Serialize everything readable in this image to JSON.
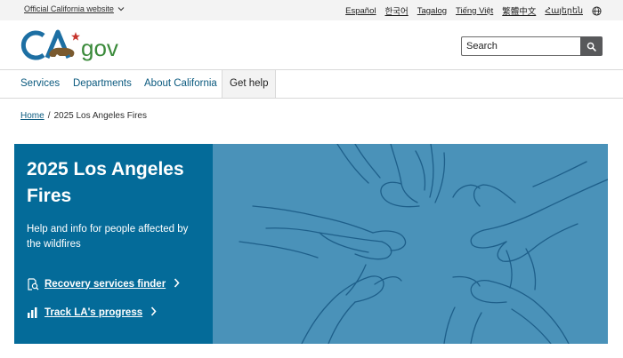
{
  "utility": {
    "official_label": "Official California website",
    "languages": [
      "Español",
      "한국어",
      "Tagalog",
      "Tiếng Việt",
      "繁體中文",
      "Հայերեն"
    ]
  },
  "header": {
    "logo_text": "CA",
    "logo_gov": "gov",
    "search_placeholder": "Search"
  },
  "nav": {
    "items": [
      "Services",
      "Departments",
      "About California",
      "Get help"
    ]
  },
  "breadcrumb": {
    "home": "Home",
    "separator": "/",
    "current": "2025 Los Angeles Fires"
  },
  "hero": {
    "title": "2025 Los Angeles Fires",
    "description": "Help and info for people affected by the wildfires",
    "links": [
      "Recovery services finder",
      "Track LA's progress"
    ],
    "colors": {
      "panel": "#046b99",
      "image": "#4a92b9"
    }
  }
}
